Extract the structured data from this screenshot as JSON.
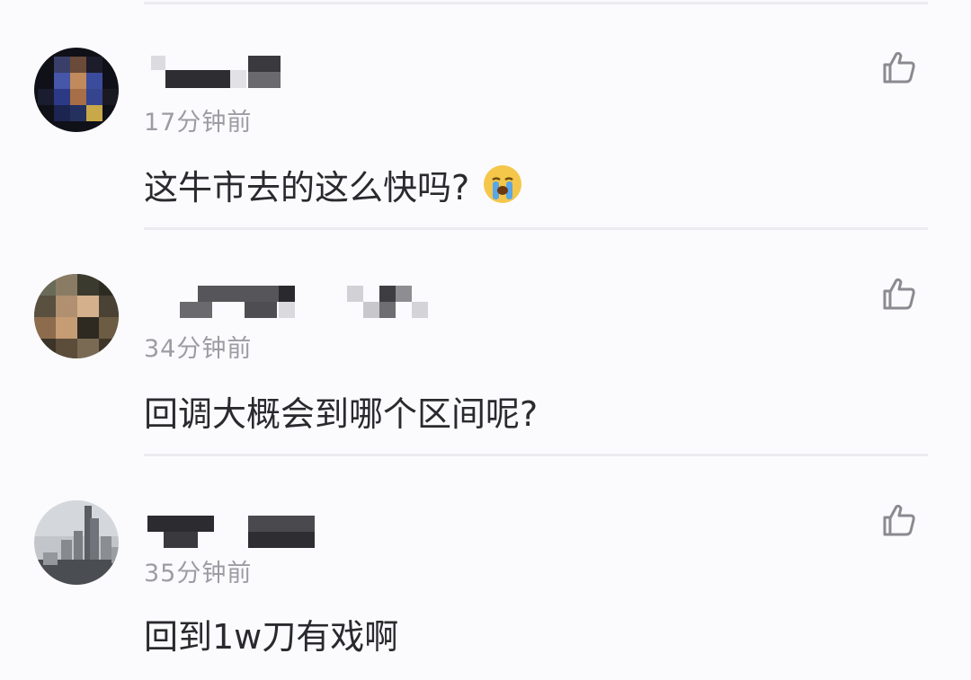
{
  "comments": [
    {
      "time": "17分钟前",
      "text": "这牛市去的这么快吗?",
      "emoji": "crying-emoji"
    },
    {
      "time": "34分钟前",
      "text": "回调大概会到哪个区间呢?"
    },
    {
      "time": "35分钟前",
      "text": "回到1w刀有戏啊"
    }
  ],
  "icons": {
    "like": "thumbs-up-outline-icon",
    "like_color": "#8a8a90"
  }
}
